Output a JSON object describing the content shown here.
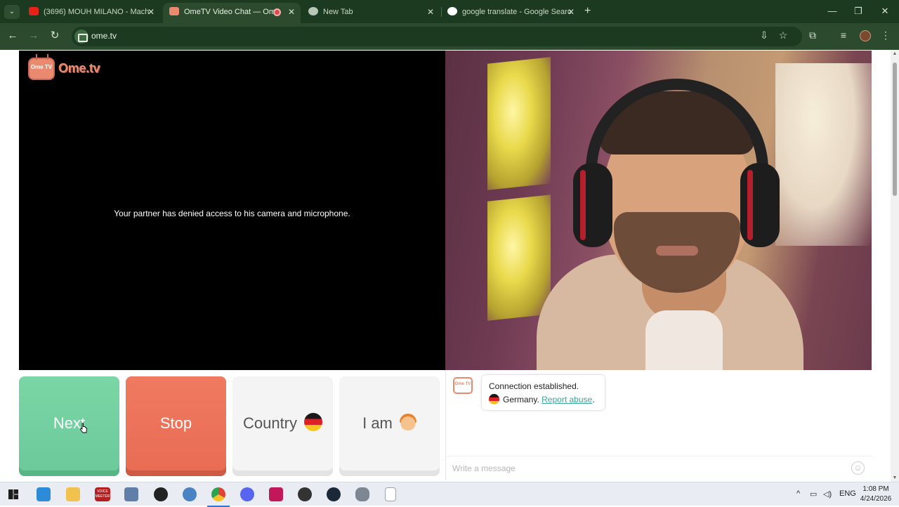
{
  "browser": {
    "tabs": [
      {
        "title": "(3696) MOUH MILANO - Mach",
        "favicon": "youtube-icon",
        "active": false
      },
      {
        "title": "OmeTV Video Chat — Ome",
        "favicon": "ometv-icon",
        "active": true,
        "recording": true
      },
      {
        "title": "New Tab",
        "favicon": "chrome-icon",
        "active": false
      },
      {
        "title": "google translate - Google Searc",
        "favicon": "google-icon",
        "active": false
      }
    ],
    "new_tab_symbol": "+",
    "close_symbol": "✕",
    "url": "ome.tv",
    "window_controls": {
      "minimize": "—",
      "maximize": "❐",
      "close": "✕"
    },
    "nav": {
      "back": "←",
      "forward": "→",
      "reload": "↻"
    },
    "toolbar_icons": {
      "install": "⇩",
      "bookmark": "☆",
      "extensions": "⧉",
      "media": "≡",
      "menu": "⋮"
    },
    "theme": {
      "frame": "#1b3a1f",
      "toolbar": "#2b4a2e"
    }
  },
  "app": {
    "logo_badge": "Ome TV",
    "logo_text": "Ome.tv",
    "partner_message": "Your partner has denied access to his camera and microphone.",
    "buttons": {
      "next": "Next",
      "stop": "Stop",
      "country": "Country",
      "i_am": "I am"
    },
    "chat": {
      "avatar_text": "Ome TV",
      "connection_text": "Connection established.",
      "country_text": "Germany.",
      "report_text": "Report abuse",
      "report_suffix": ".",
      "input_placeholder": "Write a message",
      "emoji_icon": "☺"
    },
    "colors": {
      "next": "#6bc99a",
      "stop": "#e86c53",
      "accent": "#e98a6e",
      "link": "#3aa59c"
    }
  },
  "taskbar": {
    "apps": [
      "windows-start-icon",
      "microsoft-store-icon",
      "file-explorer-icon",
      "voicemeeter-icon",
      "control-panel-icon",
      "settings-icon",
      "steam-link-icon",
      "chrome-icon",
      "discord-icon",
      "app-icon",
      "obs-icon",
      "steam-icon",
      "security-icon",
      "notepad-icon"
    ],
    "voicemeeter_label": "VOICE MEETER",
    "tray": {
      "chevron": "^",
      "language": "ENG"
    },
    "time": "1:08 PM",
    "date": "4/24/2026"
  }
}
